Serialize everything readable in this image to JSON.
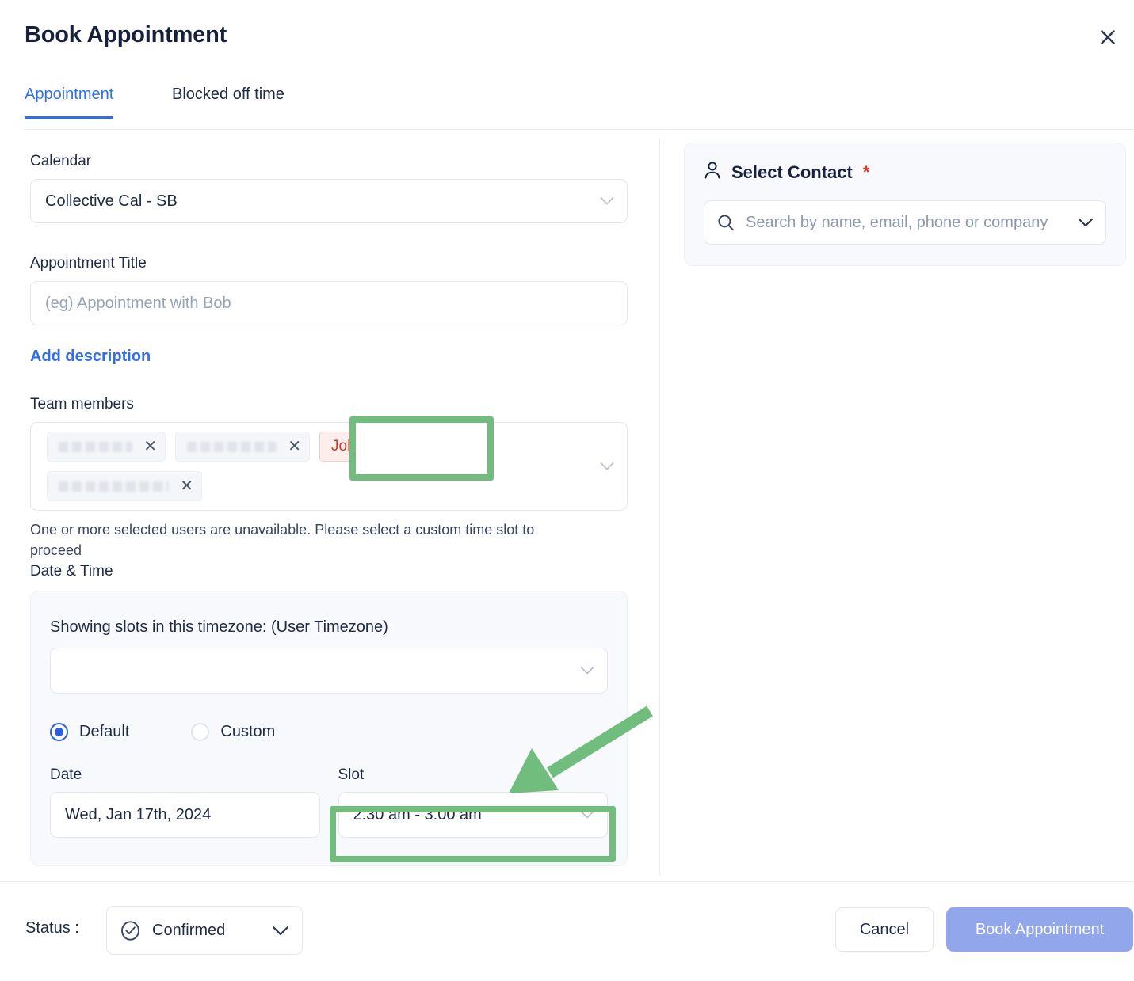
{
  "header": {
    "title": "Book Appointment",
    "close_icon": "close-icon"
  },
  "tabs": [
    {
      "label": "Appointment",
      "active": true
    },
    {
      "label": "Blocked off time",
      "active": false
    }
  ],
  "form": {
    "calendar": {
      "label": "Calendar",
      "value": "Collective Cal - SB"
    },
    "appointment_title": {
      "label": "Appointment Title",
      "value": "",
      "placeholder": "(eg) Appointment with Bob"
    },
    "add_description_link": "Add description",
    "team_members": {
      "label": "Team members",
      "chips": [
        {
          "name": "",
          "redacted": true,
          "state": "normal"
        },
        {
          "name": "",
          "redacted": true,
          "state": "normal"
        },
        {
          "name": "John",
          "redacted": false,
          "state": "unavailable"
        },
        {
          "name": "",
          "redacted": true,
          "state": "normal"
        }
      ],
      "warning": "One or more selected users are unavailable. Please select a custom time slot to proceed"
    },
    "date_time": {
      "label": "Date & Time",
      "timezone_label": "Showing slots in this timezone: (User Timezone)",
      "timezone_value": "",
      "mode_options": [
        {
          "label": "Default",
          "selected": true
        },
        {
          "label": "Custom",
          "selected": false
        }
      ],
      "date": {
        "label": "Date",
        "value": "Wed, Jan 17th, 2024"
      },
      "slot": {
        "label": "Slot",
        "value": "2:30 am - 3:00 am"
      }
    }
  },
  "contact_panel": {
    "title": "Select Contact",
    "required_marker": "*",
    "person_icon": "person-icon",
    "search": {
      "placeholder": "Search by name, email, phone or company",
      "value": "",
      "search_icon": "search-icon",
      "chevron_icon": "chevron-down-icon"
    }
  },
  "footer": {
    "status_label": "Status :",
    "status_value": "Confirmed",
    "status_icon": "check-circle-icon",
    "cancel_label": "Cancel",
    "book_label": "Book Appointment"
  },
  "annotations": {
    "highlight_color": "#70bd7e",
    "arrow": "green-arrow-pointing-to-slot",
    "highlighted_elements": [
      "team-member-chip-john",
      "slot-select"
    ]
  },
  "colors": {
    "accent_blue": "#2f6fed",
    "primary_button": "#92a6ec",
    "error_red": "#d0372a",
    "highlight_green": "#70bd7e"
  }
}
